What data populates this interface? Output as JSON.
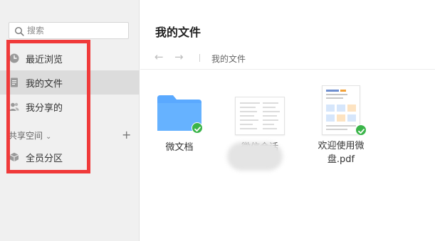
{
  "sidebar": {
    "search_placeholder": "搜索",
    "items": [
      {
        "label": "最近浏览",
        "icon": "clock-icon"
      },
      {
        "label": "我的文件",
        "icon": "document-icon"
      },
      {
        "label": "我分享的",
        "icon": "users-icon"
      }
    ],
    "section": {
      "label": "共享空间",
      "chevron": "chevron-down-icon",
      "add": "+"
    },
    "section_items": [
      {
        "label": "全员分区",
        "icon": "cube-icon"
      }
    ]
  },
  "main": {
    "title": "我的文件",
    "toolbar": {
      "back": "←",
      "forward": "→",
      "breadcrumb": "我的文件"
    },
    "files": [
      {
        "name": "微文档",
        "type": "folder",
        "synced": true
      },
      {
        "name": "微信会话",
        "type": "document",
        "synced": false
      },
      {
        "name": "欢迎使用微盘.pdf",
        "type": "pdf",
        "synced": true
      }
    ]
  },
  "colors": {
    "accent_red": "#f03a3a",
    "folder_blue": "#5aa9ff",
    "check_green": "#3bb54a"
  }
}
